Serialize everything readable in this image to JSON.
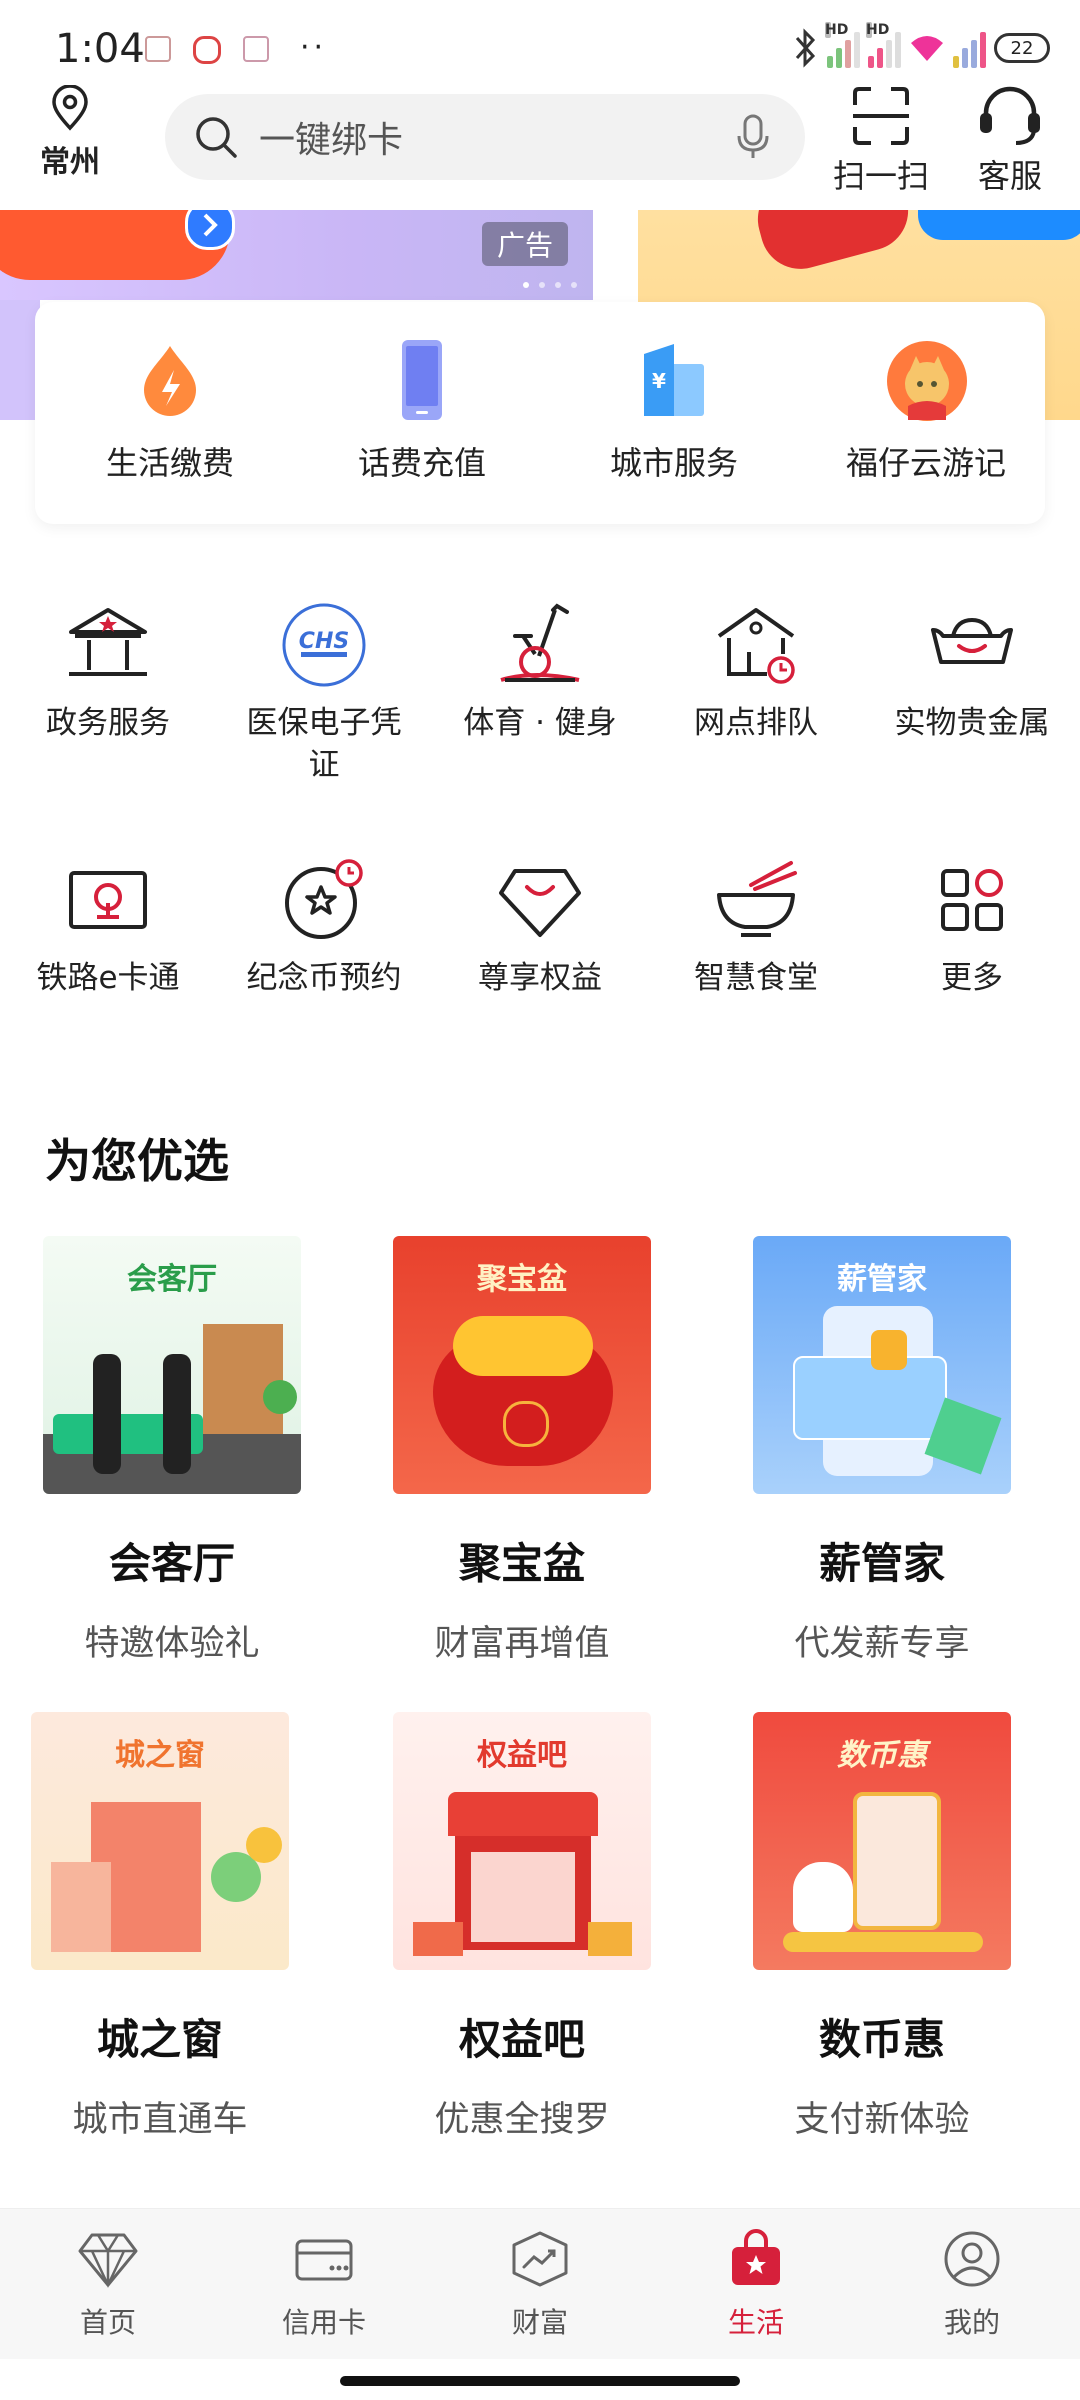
{
  "status_bar": {
    "time": "1:04",
    "battery": "22"
  },
  "header": {
    "location": "常州",
    "search_placeholder": "一键绑卡",
    "scan_label": "扫一扫",
    "service_label": "客服"
  },
  "banner": {
    "ad_badge": "广告"
  },
  "quick_services": [
    {
      "label": "生活缴费",
      "icon": "flame-drop-icon"
    },
    {
      "label": "话费充值",
      "icon": "phone-icon"
    },
    {
      "label": "城市服务",
      "icon": "city-building-icon"
    },
    {
      "label": "福仔云游记",
      "icon": "mascot-icon"
    }
  ],
  "services_row1": [
    {
      "label": "政务服务",
      "icon": "government-building-icon"
    },
    {
      "label": "医保电子凭证",
      "icon": "chs-medical-insurance-icon",
      "badge": "CHS"
    },
    {
      "label": "体育 · 健身",
      "icon": "exercise-bike-icon"
    },
    {
      "label": "网点排队",
      "icon": "branch-queue-icon"
    },
    {
      "label": "实物贵金属",
      "icon": "gold-ingot-icon"
    }
  ],
  "services_row2": [
    {
      "label": "铁路e卡通",
      "icon": "railway-card-icon"
    },
    {
      "label": "纪念币预约",
      "icon": "commemorative-coin-icon"
    },
    {
      "label": "尊享权益",
      "icon": "diamond-benefit-icon"
    },
    {
      "label": "智慧食堂",
      "icon": "noodle-bowl-icon"
    },
    {
      "label": "更多",
      "icon": "more-grid-icon"
    }
  ],
  "section": {
    "title": "为您优选",
    "cards": [
      {
        "tag": "会客厅",
        "title": "会客厅",
        "subtitle": "特邀体验礼"
      },
      {
        "tag": "聚宝盆",
        "title": "聚宝盆",
        "subtitle": "财富再增值"
      },
      {
        "tag": "薪管家",
        "title": "薪管家",
        "subtitle": "代发薪专享"
      },
      {
        "tag": "城之窗",
        "title": "城之窗",
        "subtitle": "城市直通车"
      },
      {
        "tag": "权益吧",
        "title": "权益吧",
        "subtitle": "优惠全搜罗"
      },
      {
        "tag": "数币惠",
        "title": "数币惠",
        "subtitle": "支付新体验"
      }
    ]
  },
  "bottom_nav": [
    {
      "label": "首页",
      "icon": "diamond-home-icon"
    },
    {
      "label": "信用卡",
      "icon": "credit-card-icon"
    },
    {
      "label": "财富",
      "icon": "wealth-chart-icon"
    },
    {
      "label": "生活",
      "icon": "life-bag-icon",
      "active": true
    },
    {
      "label": "我的",
      "icon": "profile-icon"
    }
  ],
  "colors": {
    "accent": "#d6203b",
    "banner_left": "#d2c3fb",
    "banner_right": "#ffd88c"
  }
}
